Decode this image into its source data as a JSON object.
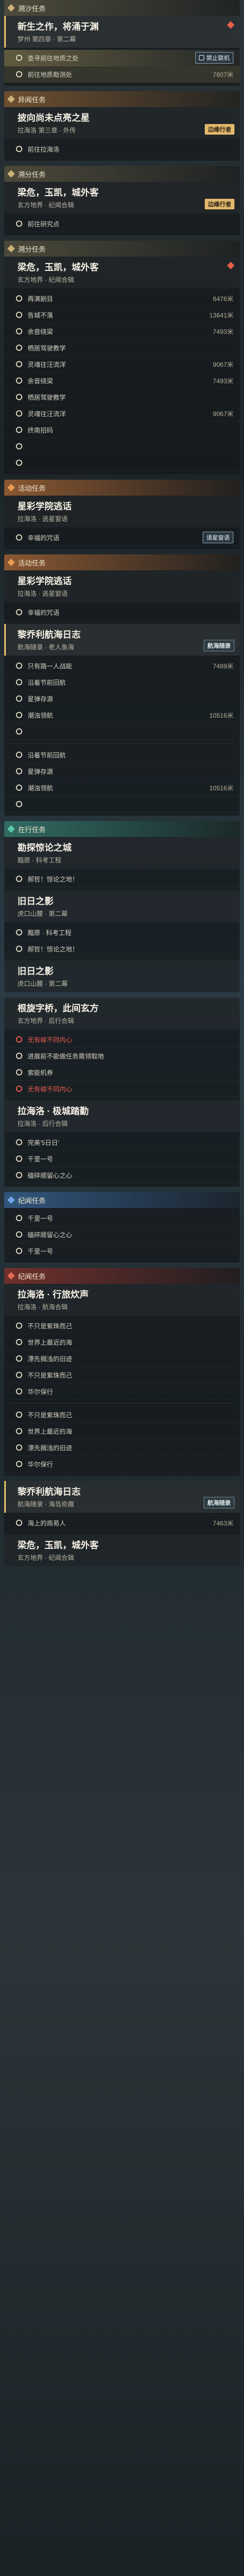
{
  "s1": {
    "category": "溯沙任务",
    "title": "新生之作，将涌于渊",
    "subtitle": "梦州 第四章 · 第二幕",
    "obj1": "查寻前往地质之处",
    "badge1": "禁止联机",
    "obj2": "前往地质勘测处",
    "dist2": "7607米"
  },
  "s2": {
    "category": "异闻任务",
    "title": "披向尚未点亮之星",
    "subtitle": "拉海洛 第三章 · 外传",
    "tag": "边缘行者",
    "obj1": "前往拉海洛"
  },
  "s3": {
    "category": "溯分任务",
    "title": "梁危，玉凯，城外客",
    "subtitle": "玄方地界 · 纪闻合辑",
    "tag": "边缘行者",
    "obj1": "前往研究点"
  },
  "s4": {
    "category": "溯分任务",
    "title": "梁危，玉凯，城外客",
    "subtitle": "玄方地界 · 纪闻合辑",
    "objs": [
      {
        "label": "再演剧目",
        "dist": "6476米"
      },
      {
        "label": "告城不落",
        "dist": "13641米"
      },
      {
        "label": "余音绕梁",
        "dist": "7493米"
      },
      {
        "label": "栖居驾驶教学",
        "dist": ""
      },
      {
        "label": "灵魂往汪流洋",
        "dist": "9067米"
      },
      {
        "label": "余音绕梁",
        "dist": "7493米"
      },
      {
        "label": "栖居驾驶教学",
        "dist": ""
      },
      {
        "label": "灵魂往汪流洋",
        "dist": "9067米"
      },
      {
        "label": "终南招码",
        "dist": ""
      },
      {
        "label": "",
        "dist": ""
      },
      {
        "label": "",
        "dist": ""
      }
    ]
  },
  "s5": {
    "category": "活动任务",
    "title": "星彩学院逃话",
    "subtitle": "拉海洛 · 逃星窗语",
    "obj1": "幸福的咒语",
    "badge1": "请星窗语"
  },
  "s6": {
    "category": "活动任务",
    "title": "星彩学院逃话",
    "subtitle": "拉海洛 · 逃星窗语",
    "obj1": "幸福的咒语",
    "title2": "黎乔利航海日志",
    "subtitle2": "航海随录 · 老人鱼海",
    "tag2": "航海随录",
    "objs": [
      {
        "label": "只有路一人战能",
        "dist": "7489米"
      },
      {
        "label": "沿着节前回航",
        "dist": ""
      },
      {
        "label": "星弹存源",
        "dist": ""
      },
      {
        "label": "潮浊领航",
        "dist": "10516米"
      },
      {
        "label": "",
        "dist": ""
      },
      {
        "label": "沿着节前回航",
        "dist": ""
      },
      {
        "label": "星弹存源",
        "dist": ""
      },
      {
        "label": "潮浊领航",
        "dist": "10516米"
      },
      {
        "label": "",
        "dist": ""
      }
    ]
  },
  "s7": {
    "category": "在行任务",
    "title": "勘探惊论之城",
    "subtitle": "黯原 · 科考工程",
    "obj1": "郝哲！惊论之地！",
    "title2": "旧日之影",
    "subtitle2": "虎口山麓 · 第二幕",
    "obj2": "黯原 · 科考工程",
    "obj3": "郝哲！惊论之地！",
    "title3": "旧日之影",
    "subtitle3": "虎口山麓 · 第二幕"
  },
  "s8": {
    "title": "根旋字桥，此间玄方",
    "subtitle": "玄方地界 · 后行合辑",
    "obj1": "无有峻不同内心",
    "obj2": "进展前不能做任务需领取地",
    "obj3": "索能机券",
    "obj4": "无有峻不同内心",
    "title2": "拉海洛 · 极城踏勤",
    "subtitle2": "拉海洛 · 后行合辑",
    "obj5": "完美'5日日'",
    "obj6": "千里一号",
    "obj7": "磕碎顺留心之心"
  },
  "s9": {
    "category": "纪闻任务",
    "obj1": "千里一号",
    "obj2": "磕碎顺留心之心",
    "obj3": "千里一号"
  },
  "s10": {
    "category": "纪闻任务",
    "title": "拉海洛 · 行旅炊声",
    "subtitle": "拉海洛 · 航海合辑",
    "objs": [
      "不只是紫珠而己",
      "世界上最近的海",
      "漂先搁浅的旧迹",
      "不只是紫珠而己",
      "华尔保行",
      "不只是紫珠而己",
      "世界上最近的海",
      "漂先搁浅的旧迹",
      "华尔保行"
    ]
  },
  "s11": {
    "title": "黎乔利航海日志",
    "subtitle": "航海随录 · 海岛奇趣",
    "tag": "航海随录",
    "obj1": "海上的商易人",
    "dist1": "7463米",
    "title2": "梁危，玉凯，城外客",
    "subtitle2": "玄方地界 · 纪闻合辑"
  }
}
